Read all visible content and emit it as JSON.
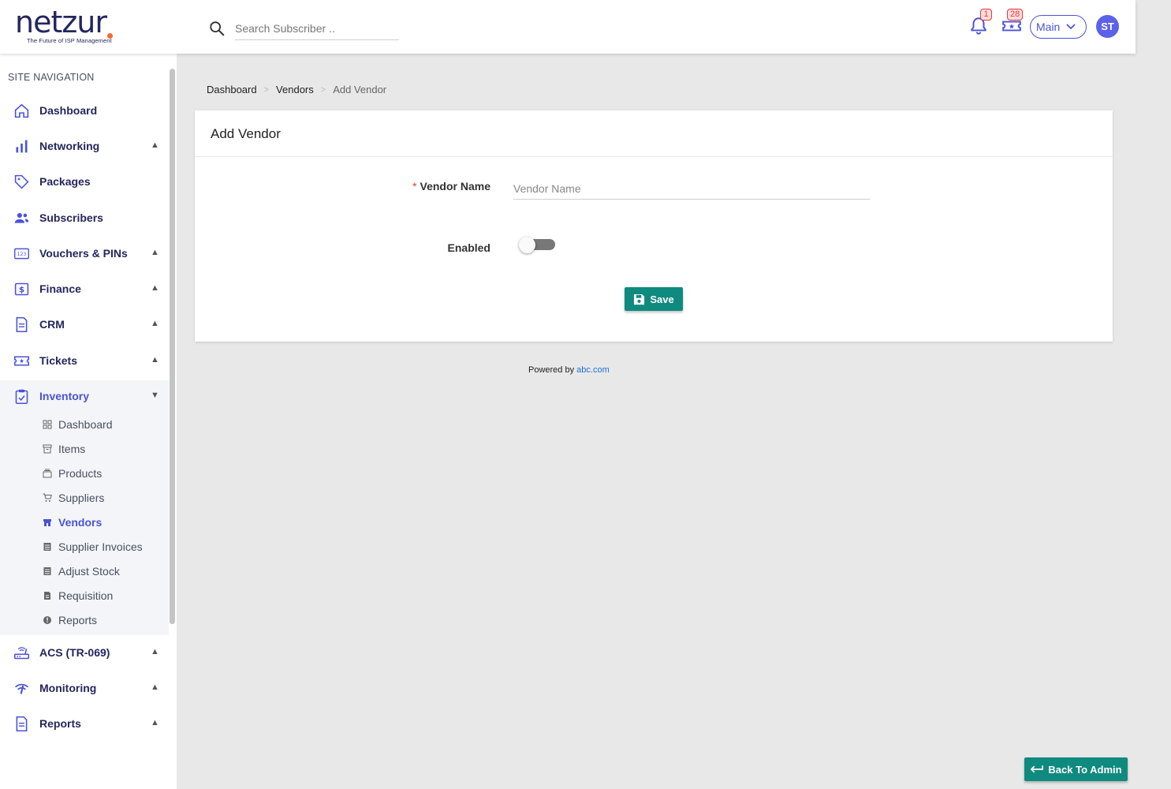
{
  "brand": {
    "name": "netzur",
    "tagline": "The Future of ISP Management"
  },
  "search": {
    "placeholder": "Search Subscriber .."
  },
  "header": {
    "notifications_count": "1",
    "tickets_count": "28",
    "workspace": "Main",
    "user_initials": "ST"
  },
  "sidebar": {
    "heading": "SITE NAVIGATION",
    "items": [
      {
        "label": "Dashboard",
        "icon": "home-icon"
      },
      {
        "label": "Networking",
        "icon": "bar-chart-icon"
      },
      {
        "label": "Packages",
        "icon": "tag-icon"
      },
      {
        "label": "Subscribers",
        "icon": "users-icon"
      },
      {
        "label": "Vouchers & PINs",
        "icon": "voucher-icon"
      },
      {
        "label": "Finance",
        "icon": "dollar-icon"
      },
      {
        "label": "CRM",
        "icon": "document-icon"
      },
      {
        "label": "Tickets",
        "icon": "ticket-icon"
      },
      {
        "label": "Inventory",
        "icon": "clipboard-check-icon"
      },
      {
        "label": "ACS (TR-069)",
        "icon": "router-icon"
      },
      {
        "label": "Monitoring",
        "icon": "signal-icon"
      },
      {
        "label": "Reports",
        "icon": "report-icon"
      }
    ],
    "inventory_sub": [
      {
        "label": "Dashboard",
        "icon": "grid-icon"
      },
      {
        "label": "Items",
        "icon": "archive-icon"
      },
      {
        "label": "Products",
        "icon": "stack-icon"
      },
      {
        "label": "Suppliers",
        "icon": "cart-icon"
      },
      {
        "label": "Vendors",
        "icon": "store-icon"
      },
      {
        "label": "Supplier Invoices",
        "icon": "invoice-icon"
      },
      {
        "label": "Adjust Stock",
        "icon": "list-icon"
      },
      {
        "label": "Requisition",
        "icon": "file-icon"
      },
      {
        "label": "Reports",
        "icon": "info-icon"
      }
    ]
  },
  "breadcrumb": {
    "items": [
      "Dashboard",
      "Vendors"
    ],
    "current": "Add Vendor",
    "separator": ">"
  },
  "form": {
    "title": "Add Vendor",
    "vendor_name_label": "Vendor Name",
    "vendor_name_placeholder": "Vendor Name",
    "vendor_name_value": "",
    "required_mark": "*",
    "enabled_label": "Enabled",
    "enabled": false,
    "save_label": "Save"
  },
  "footer": {
    "text": "Powered by",
    "link": "abc.com"
  },
  "back_button": {
    "label": "Back To Admin"
  },
  "colors": {
    "accent": "#4a53d8",
    "primary_button": "#0f8a7f",
    "brand_dark": "#24265e",
    "badge": "#e53935"
  }
}
